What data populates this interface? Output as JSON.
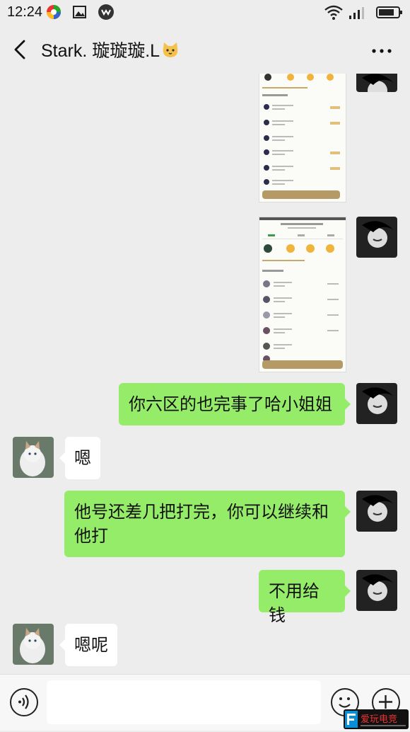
{
  "status_bar": {
    "time": "12:24"
  },
  "header": {
    "title": "Stark. 璇璇璇.L"
  },
  "messages": [
    {
      "sender": "me",
      "text": "你六区的也完事了哈小姐姐"
    },
    {
      "sender": "them",
      "text": "嗯"
    },
    {
      "sender": "me",
      "text_line1": "他号还差几把打完，你可以继续和",
      "text_line2": "他打"
    },
    {
      "sender": "me",
      "text": "不用给钱"
    },
    {
      "sender": "them",
      "text": "嗯呢"
    }
  ],
  "watermark": {
    "text": "爱玩电竞"
  },
  "colors": {
    "my_bubble": "#95ec69",
    "their_bubble": "#ffffff",
    "background": "#ededed"
  },
  "icons": [
    "back-icon",
    "more-icon",
    "voice-icon",
    "emoji-icon",
    "plus-icon"
  ]
}
